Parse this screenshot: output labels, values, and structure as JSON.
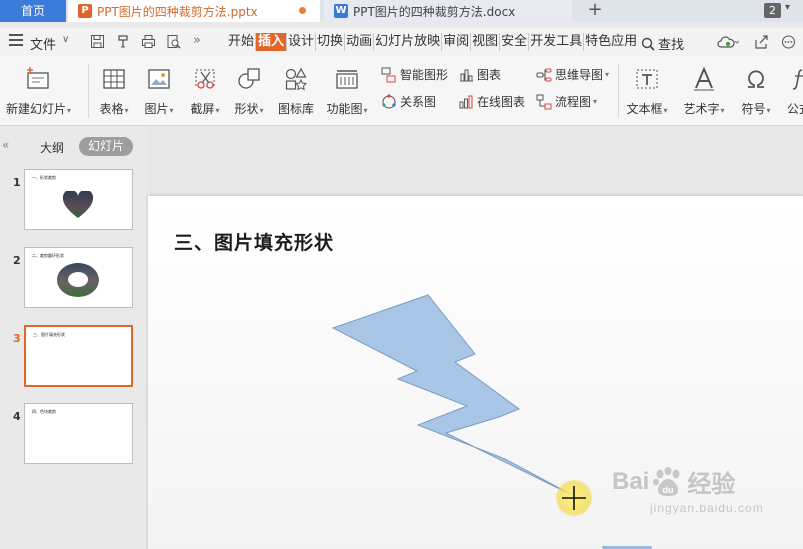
{
  "tabbar": {
    "home_label": "首页",
    "tabs": [
      {
        "label": "PPT图片的四种裁剪方法.pptx",
        "icon": "ppt-file-icon",
        "active": true
      },
      {
        "label": "PPT图片的四种裁剪方法.docx",
        "icon": "word-file-icon",
        "active": false
      }
    ],
    "window_count": "2"
  },
  "menubar": {
    "file_label": "文件",
    "more": "»",
    "tabs": [
      "开始",
      "插入",
      "设计",
      "切换",
      "动画",
      "幻灯片放映",
      "审阅",
      "视图",
      "安全",
      "开发工具",
      "特色应用"
    ],
    "active_tab": "插入",
    "search_label": "查找"
  },
  "ribbon": {
    "new_slide": "新建幻灯片",
    "table": "表格",
    "picture": "图片",
    "screenshot": "截屏",
    "shape": "形状",
    "icon_library": "图标库",
    "function_chart": "功能图",
    "smart_art": "智能图形",
    "chart": "图表",
    "mind_map": "思维导图",
    "relation": "关系图",
    "online_chart": "在线图表",
    "flowchart": "流程图",
    "textbox": "文本框",
    "word_art": "艺术字",
    "symbol": "符号",
    "formula": "公式"
  },
  "panel": {
    "outline_tab": "大纲",
    "slides_tab": "幻灯片",
    "collapse": "«",
    "slides": [
      {
        "num": "1",
        "title": "一、形状裁剪"
      },
      {
        "num": "2",
        "title": "二、裁剪圆环形状"
      },
      {
        "num": "3",
        "title": "三、图片填充形状"
      },
      {
        "num": "4",
        "title": "四、色块裁剪"
      }
    ],
    "active_slide": "3"
  },
  "slide": {
    "title": "三、图片填充形状"
  },
  "watermark": {
    "brand_left": "Bai",
    "brand_right": "经验",
    "url": "jingyan.baidu.com"
  },
  "colors": {
    "accent": "#e2662a",
    "home_tab": "#3d7bd8",
    "shape_fill": "#a9c6e6",
    "shape_stroke": "#7a9cc4"
  }
}
